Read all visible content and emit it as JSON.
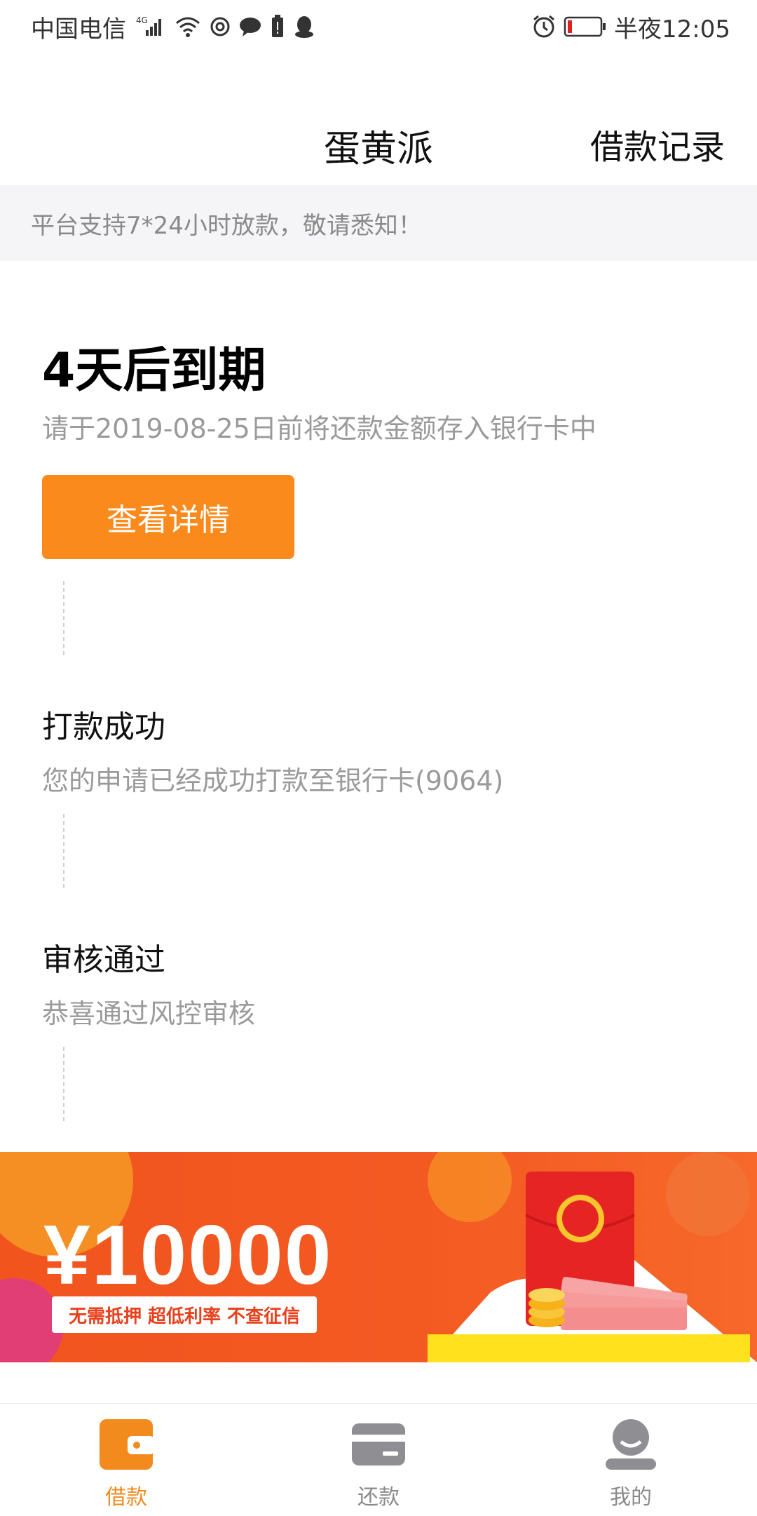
{
  "status_bar": {
    "carrier": "中国电信",
    "network": "4G",
    "time": "半夜12:05"
  },
  "nav": {
    "title": "蛋黄派",
    "right_link": "借款记录"
  },
  "notice": "平台支持7*24小时放款，敬请悉知！",
  "loan_status": {
    "title": "4天后到期",
    "subtitle": "请于2019-08-25日前将还款金额存入银行卡中",
    "button_label": "查看详情"
  },
  "steps": [
    {
      "title": "打款成功",
      "subtitle": "您的申请已经成功打款至银行卡(9064)"
    },
    {
      "title": "审核通过",
      "subtitle": "恭喜通过风控审核"
    }
  ],
  "banner": {
    "amount": "¥10000",
    "tagline": "无需抵押  超低利率  不查征信"
  },
  "tabs": [
    {
      "label": "借款",
      "icon": "wallet-icon",
      "active": true
    },
    {
      "label": "还款",
      "icon": "card-icon",
      "active": false
    },
    {
      "label": "我的",
      "icon": "user-icon",
      "active": false
    }
  ],
  "colors": {
    "accent": "#fb8a1d",
    "tab_active": "#f28a1e",
    "banner": "#f2541e"
  }
}
